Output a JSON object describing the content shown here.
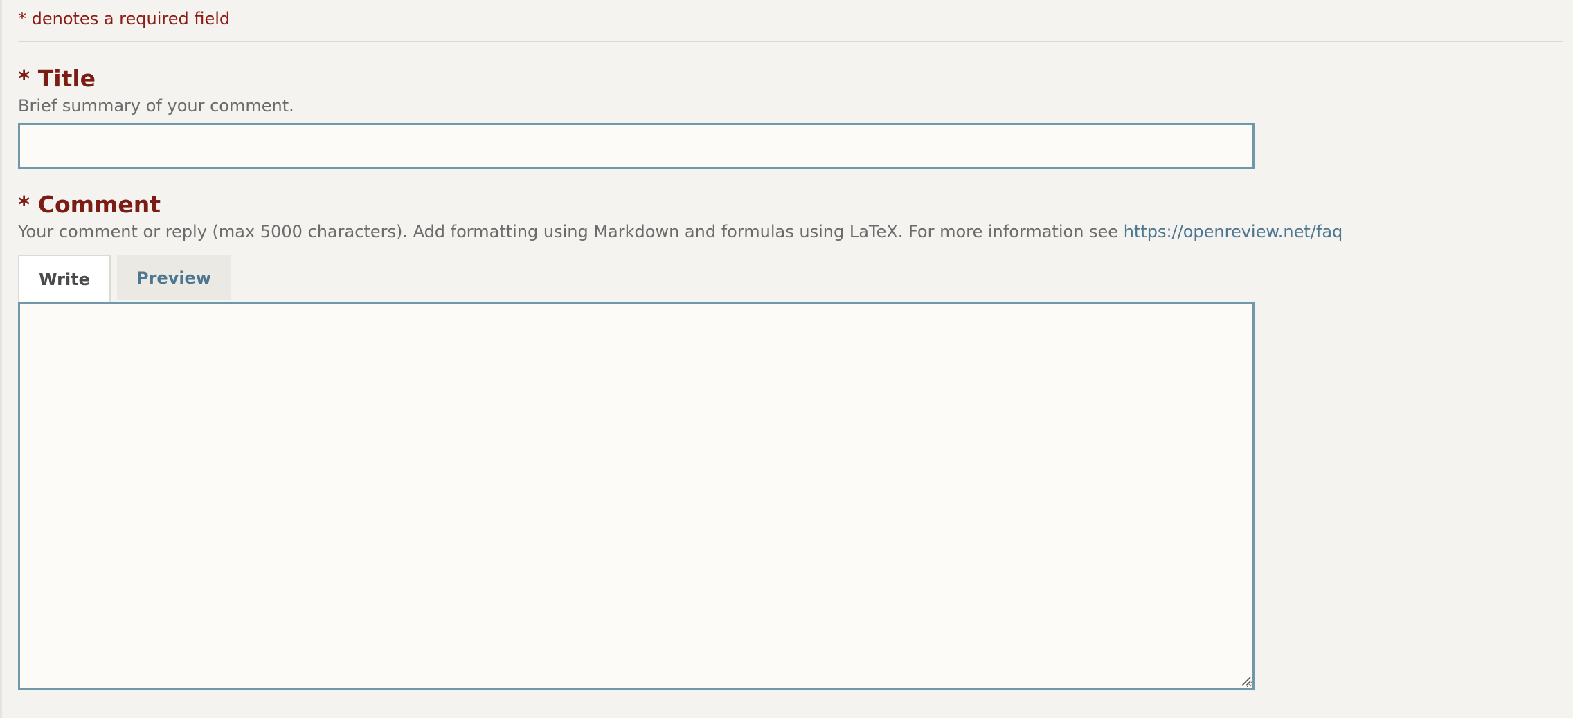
{
  "form": {
    "required_note": "* denotes a required field",
    "title_field": {
      "label": "* Title",
      "description": "Brief summary of your comment.",
      "value": "",
      "placeholder": ""
    },
    "comment_field": {
      "label": "* Comment",
      "description": "Your comment or reply (max 5000 characters). Add formatting using Markdown and formulas using LaTeX. For more information see ",
      "link_text": "https://openreview.net/faq",
      "value": "",
      "placeholder": ""
    },
    "tabs": [
      {
        "label": "Write",
        "active": true
      },
      {
        "label": "Preview",
        "active": false
      }
    ]
  },
  "colors": {
    "background": "#f4f3f0",
    "label": "#7c1d15",
    "required_note": "#8c1b13",
    "description": "#6b6b6b",
    "link": "#4d7790",
    "input_border": "#6f98ab",
    "input_bg": "#fdfbf7"
  }
}
